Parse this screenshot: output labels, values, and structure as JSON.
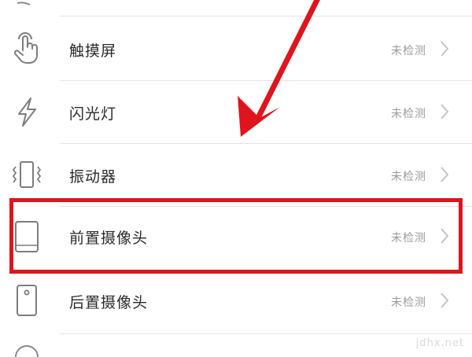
{
  "items": [
    {
      "label": "触摸屏",
      "status": "未检测",
      "icon": "touch-hand-icon"
    },
    {
      "label": "闪光灯",
      "status": "未检测",
      "icon": "flash-bolt-icon"
    },
    {
      "label": "振动器",
      "status": "未检测",
      "icon": "vibration-phone-icon"
    },
    {
      "label": "前置摄像头",
      "status": "未检测",
      "icon": "front-camera-phone-icon"
    },
    {
      "label": "后置摄像头",
      "status": "未检测",
      "icon": "rear-camera-phone-icon"
    }
  ],
  "highlighted_item": "前置摄像头",
  "annotation_color": "#e0141c",
  "watermark": "jdhx.net"
}
